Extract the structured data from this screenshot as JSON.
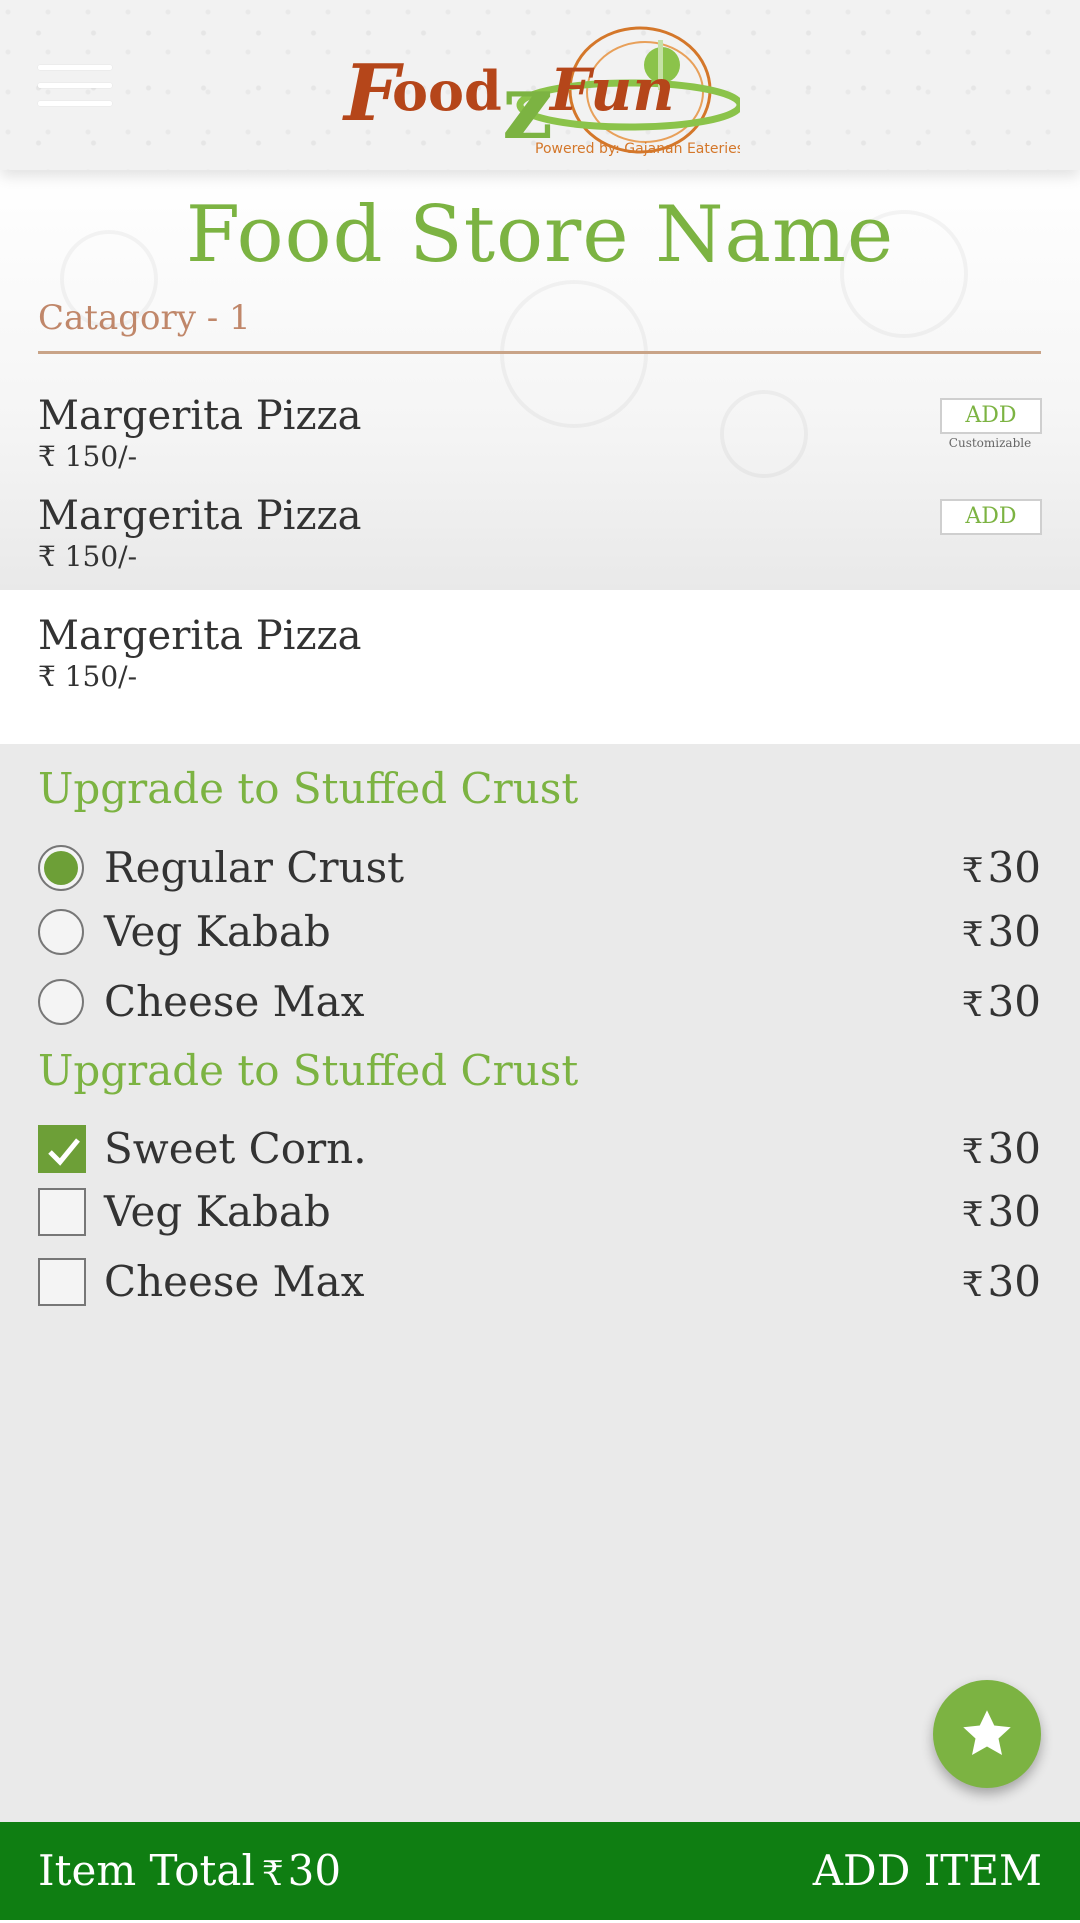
{
  "header": {
    "logo_text": "FoodzFun",
    "logo_tagline": "Powered by: Gajanan Eateries"
  },
  "store": {
    "name": "Food Store Name",
    "category": "Catagory - 1"
  },
  "menu_items": [
    {
      "name": "Margerita Pizza",
      "price": "₹ 150/-",
      "add_label": "ADD",
      "note": "Customizable"
    },
    {
      "name": "Margerita Pizza",
      "price": "₹ 150/-",
      "add_label": "ADD"
    },
    {
      "name": "Margerita Pizza",
      "price": "₹ 150/-"
    }
  ],
  "options": {
    "groups": [
      {
        "title": "Upgrade to Stuffed Crust",
        "type": "radio",
        "items": [
          {
            "label": "Regular Crust",
            "currency": "₹",
            "price": "30",
            "selected": true
          },
          {
            "label": "Veg Kabab",
            "currency": "₹",
            "price": "30",
            "selected": false
          },
          {
            "label": "Cheese Max",
            "currency": "₹",
            "price": "30",
            "selected": false
          }
        ]
      },
      {
        "title": "Upgrade to Stuffed Crust",
        "type": "checkbox",
        "items": [
          {
            "label": "Sweet Corn.",
            "currency": "₹",
            "price": "30",
            "selected": true
          },
          {
            "label": "Veg Kabab",
            "currency": "₹",
            "price": "30",
            "selected": false
          },
          {
            "label": "Cheese Max",
            "currency": "₹",
            "price": "30",
            "selected": false
          }
        ]
      }
    ]
  },
  "footer": {
    "total_label": "Item Total",
    "currency": "₹",
    "total_value": "30",
    "add_item_label": "ADD ITEM"
  },
  "colors": {
    "accent": "#7cb342",
    "selected": "#6d9f37",
    "footer": "#0f7e12",
    "category": "#c0876a",
    "logo_brown": "#b5461a"
  },
  "icons": {
    "menu": "hamburger-menu-icon",
    "fab": "star-icon",
    "check": "checkmark-icon"
  }
}
